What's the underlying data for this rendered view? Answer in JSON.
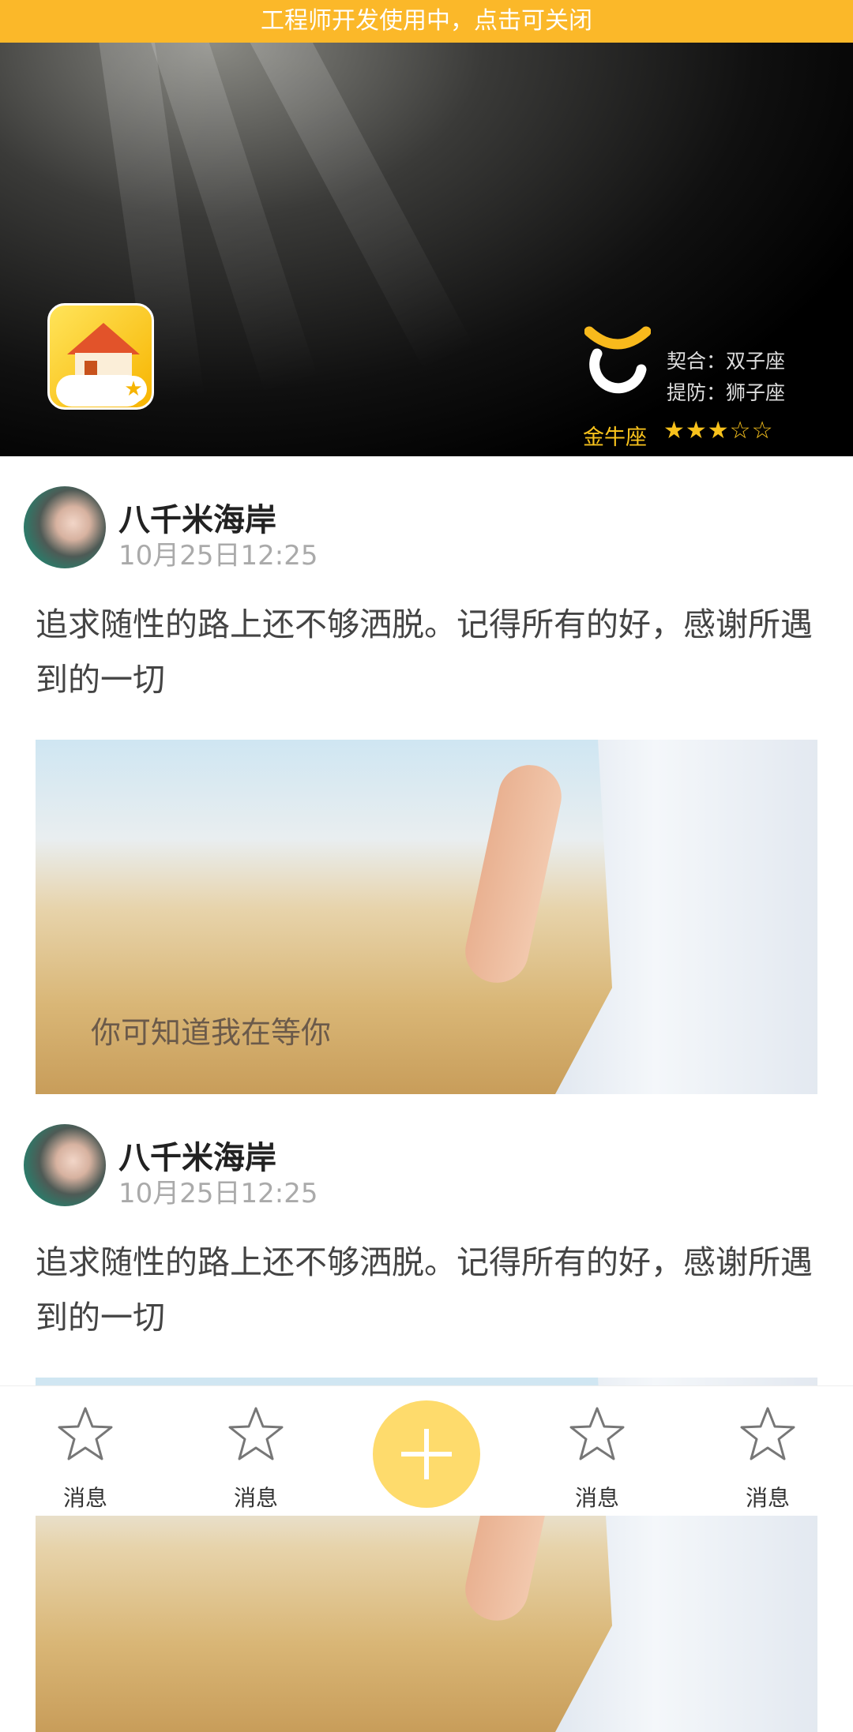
{
  "dev_banner": "工程师开发使用中，点击可关闭",
  "header": {
    "zodiac": {
      "match_line": "契合：双子座",
      "beware_line": "提防：狮子座",
      "sign": "金牛座",
      "rating": 3,
      "rating_max": 5,
      "stars": "★★★☆☆"
    }
  },
  "posts": [
    {
      "author": "八千米海岸",
      "time": "10月25日12:25",
      "text": "追求随性的路上还不够洒脱。记得所有的好，感谢所遇到的一切",
      "image_caption": "你可知道我在等你"
    },
    {
      "author": "八千米海岸",
      "time": "10月25日12:25",
      "text": "追求随性的路上还不够洒脱。记得所有的好，感谢所遇到的一切"
    }
  ],
  "nav": {
    "items": [
      {
        "label": "消息"
      },
      {
        "label": "消息"
      },
      {
        "label": "消息"
      },
      {
        "label": "消息"
      }
    ],
    "accent": "#fedb6c"
  }
}
